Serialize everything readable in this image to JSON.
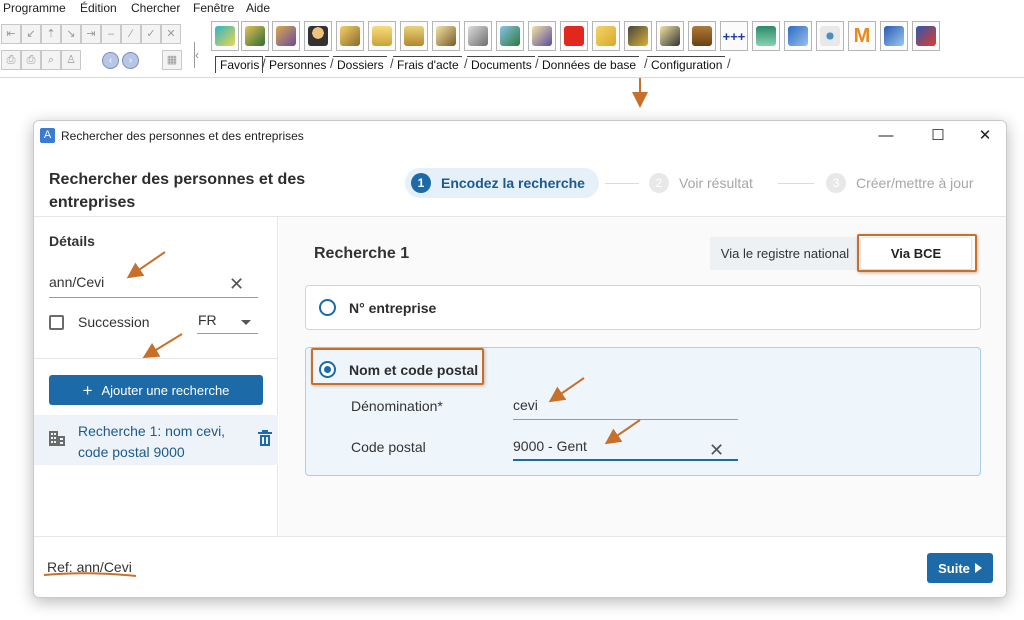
{
  "menu": [
    "Programme",
    "Édition",
    "Chercher",
    "Fenêtre",
    "Aide"
  ],
  "tabs": [
    "Favoris",
    "Personnes",
    "Dossiers",
    "Frais d'acte",
    "Documents",
    "Données de base",
    "Configuration"
  ],
  "active_tab": "Favoris",
  "colors": {
    "primary": "#1c6aa8",
    "primary_text": "#1c5a8e",
    "annotation": "#c8702a",
    "selected_bg": "#eef6fc"
  },
  "dialog": {
    "window_title": "Rechercher des personnes et des entreprises",
    "app_icon_letter": "A",
    "page_title": "Rechercher des personnes et des entreprises",
    "steps": [
      {
        "num": "1",
        "label": "Encodez la recherche",
        "state": "active"
      },
      {
        "num": "2",
        "label": "Voir résultat",
        "state": "inactive"
      },
      {
        "num": "3",
        "label": "Créer/mettre à jour",
        "state": "inactive"
      }
    ],
    "sidebar": {
      "details_label": "Détails",
      "ref_value": "ann/Cevi",
      "succession_label": "Succession",
      "succession_checked": false,
      "language_value": "FR",
      "add_button_label": "Ajouter une recherche",
      "search_item_text": "Recherche 1: nom cevi, code postal 9000"
    },
    "main": {
      "title": "Recherche 1",
      "toggle_national": "Via le registre national",
      "toggle_bce": "Via BCE",
      "toggle_selected": "Via BCE",
      "option_enterprise": "N° entreprise",
      "option_name_postal": "Nom et code postal",
      "selected_option": "Nom et code postal",
      "denomination_label": "Dénomination*",
      "denomination_value": "cevi",
      "postal_label": "Code postal",
      "postal_value": "9000 - Gent"
    },
    "footer": {
      "ref_text": "Ref: ann/Cevi",
      "suite_label": "Suite"
    }
  }
}
